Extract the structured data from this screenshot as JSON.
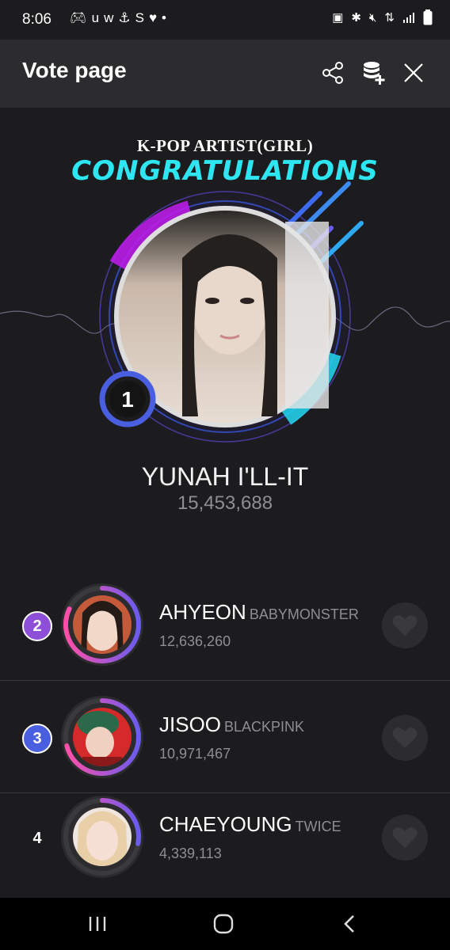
{
  "status_bar": {
    "time": "8:06",
    "notification_icons": [
      "game-controller-icon",
      "u-icon",
      "w-icon",
      "anchor-icon",
      "shazam-icon",
      "heart-icon",
      "dot-icon"
    ],
    "system_icons": [
      "nfc-icon",
      "bluetooth-icon",
      "mute-icon",
      "data-icon",
      "signal-icon",
      "battery-icon"
    ]
  },
  "header": {
    "title": "Vote page",
    "actions": [
      "share-icon",
      "add-database-icon",
      "close-icon"
    ]
  },
  "hero": {
    "category": "K-POP ARTIST(GIRL)",
    "headline": "CONGRATULATIONS",
    "winner": {
      "rank": "1",
      "name": "YUNAH I'LL-IT",
      "votes": "15,453,688"
    }
  },
  "ranking": [
    {
      "rank": "2",
      "name": "AHYEON",
      "group": "BABYMONSTER",
      "votes": "12,636,260",
      "badge_color": "#8e4fd8",
      "ring_share": 0.82
    },
    {
      "rank": "3",
      "name": "JISOO",
      "group": "BLACKPINK",
      "votes": "10,971,467",
      "badge_color": "#4a5fe0",
      "ring_share": 0.71
    },
    {
      "rank": "4",
      "name": "CHAEYOUNG",
      "group": "TWICE",
      "votes": "4,339,113",
      "badge_color": "",
      "ring_share": 0.28
    }
  ],
  "nav": {
    "buttons": [
      "recents-icon",
      "home-icon",
      "back-icon"
    ]
  },
  "colors": {
    "accent_cyan": "#2ee6f2",
    "accent_purple": "#a020f0",
    "ring_gradient_start": "#ff4fa8",
    "ring_gradient_end": "#6a5cf0",
    "background": "#1c1c1e",
    "header_bg": "#2c2c2e"
  }
}
